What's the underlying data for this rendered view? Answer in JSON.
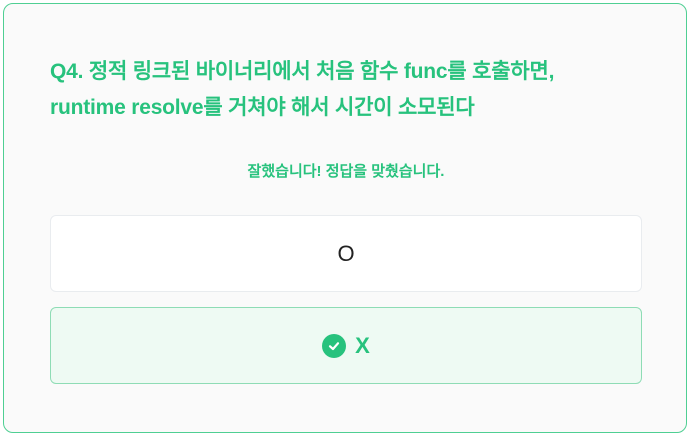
{
  "quiz": {
    "question_line1": "Q4. 정적 링크된 바이너리에서 처음 함수 func를 호출하면,",
    "question_line2": "runtime resolve를 거쳐야 해서 시간이 소모된다",
    "feedback": "잘했습니다! 정답을 맞췄습니다.",
    "options": [
      {
        "label": "O",
        "selected": false
      },
      {
        "label": "X",
        "selected": true,
        "correct": true
      }
    ],
    "correct_icon": "check-circle-icon"
  },
  "colors": {
    "accent": "#27c27d",
    "correct_bg": "#eefaf3",
    "correct_border": "#8edcb5"
  }
}
